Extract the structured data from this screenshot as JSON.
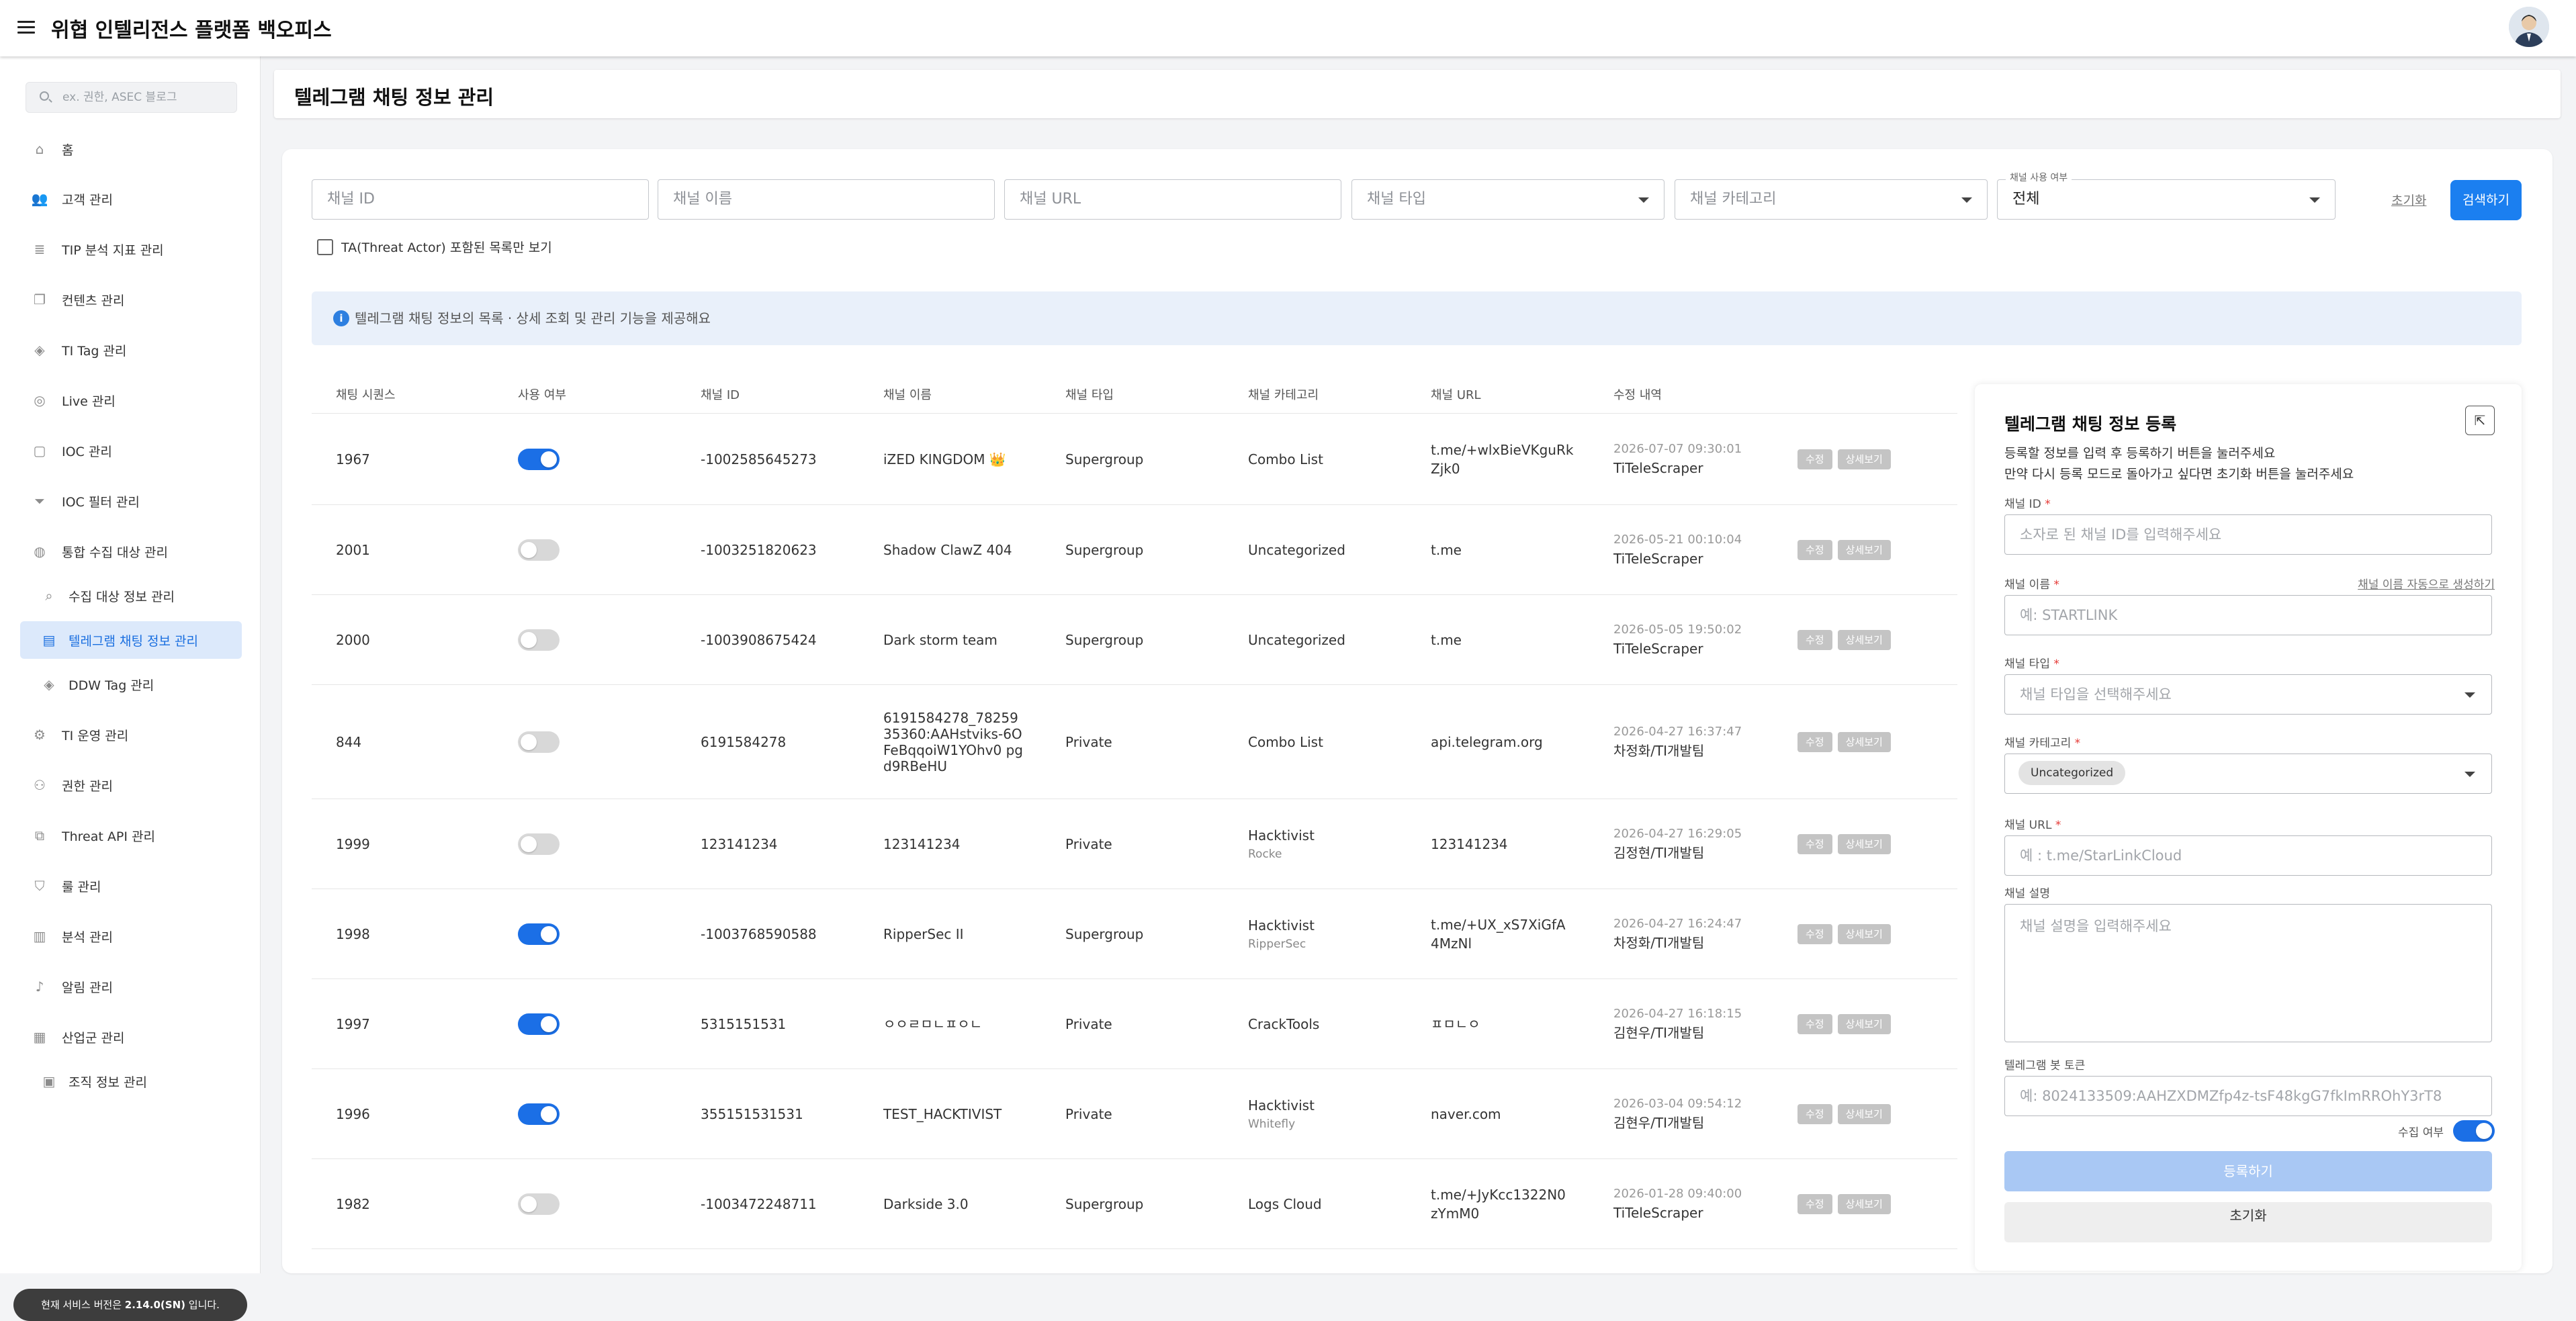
{
  "app": {
    "title": "위협 인텔리전스 플랫폼 백오피스"
  },
  "sidebar": {
    "search_placeholder": "ex. 권한, ASEC 블로그",
    "items": [
      {
        "label": "홈",
        "icon": "home-icon"
      },
      {
        "label": "고객 관리",
        "icon": "users-icon"
      },
      {
        "label": "TIP 분석 지표 관리",
        "icon": "database-icon"
      },
      {
        "label": "컨텐츠 관리",
        "icon": "copy-icon"
      },
      {
        "label": "TI Tag 관리",
        "icon": "tag-icon"
      },
      {
        "label": "Live 관리",
        "icon": "broadcast-icon"
      },
      {
        "label": "IOC 관리",
        "icon": "file-icon"
      },
      {
        "label": "IOC 필터 관리",
        "icon": "filter-icon"
      },
      {
        "label": "통합 수집 대상 관리",
        "icon": "globe-icon"
      },
      {
        "label": "수집 대상 정보 관리",
        "icon": "search-doc-icon"
      },
      {
        "label": "텔레그램 채팅 정보 관리",
        "icon": "chat-icon"
      },
      {
        "label": "DDW Tag 관리",
        "icon": "tag-icon"
      },
      {
        "label": "TI 운영 관리",
        "icon": "user-gear-icon"
      },
      {
        "label": "권한 관리",
        "icon": "group-icon"
      },
      {
        "label": "Threat API 관리",
        "icon": "api-icon"
      },
      {
        "label": "룰 관리",
        "icon": "shield-icon"
      },
      {
        "label": "분석 관리",
        "icon": "report-icon"
      },
      {
        "label": "알림 관리",
        "icon": "bell-icon"
      },
      {
        "label": "산업군 관리",
        "icon": "bar-chart-icon"
      },
      {
        "label": "조직 정보 관리",
        "icon": "org-icon"
      }
    ],
    "version_prefix": "현재 서비스 버전은 ",
    "version": "2.14.0(SN)",
    "version_suffix": " 입니다."
  },
  "page": {
    "title": "텔레그램 채팅 정보 관리"
  },
  "filters": {
    "channel_id": "채널 ID",
    "channel_name": "채널 이름",
    "channel_url": "채널 URL",
    "channel_type": "채널 타입",
    "channel_category": "채널 카테고리",
    "use_label": "채널 사용 여부",
    "use_value": "전체",
    "reset": "초기화",
    "search": "검색하기",
    "ta_only": "TA(Threat Actor) 포함된 목록만 보기"
  },
  "info": {
    "text": "텔레그램 채팅 정보의 목록 · 상세 조회 및 관리 기능을 제공해요"
  },
  "table": {
    "headers": [
      "채팅 시퀀스",
      "사용 여부",
      "채널 ID",
      "채널 이름",
      "채널 타입",
      "채널 카테고리",
      "채널 URL",
      "수정 내역"
    ],
    "edit_label": "수정",
    "detail_label": "상세보기",
    "rows": [
      {
        "seq": "1967",
        "enabled": true,
        "channel_id": "-1002585645273",
        "name": "iZED KINGDOM 👑",
        "type": "Supergroup",
        "category": "Combo List",
        "category_sub": "",
        "url": "t.me/+wlxBieVKguRk Zjk0",
        "mod_time": "2026-07-07 09:30:01",
        "mod_by": "TiTeleScraper"
      },
      {
        "seq": "2001",
        "enabled": false,
        "channel_id": "-1003251820623",
        "name": "Shadow ClawZ 404",
        "type": "Supergroup",
        "category": "Uncategorized",
        "category_sub": "",
        "url": "t.me",
        "mod_time": "2026-05-21 00:10:04",
        "mod_by": "TiTeleScraper"
      },
      {
        "seq": "2000",
        "enabled": false,
        "channel_id": "-1003908675424",
        "name": "Dark storm team",
        "type": "Supergroup",
        "category": "Uncategorized",
        "category_sub": "",
        "url": "t.me",
        "mod_time": "2026-05-05 19:50:02",
        "mod_by": "TiTeleScraper"
      },
      {
        "seq": "844",
        "enabled": false,
        "channel_id": "6191584278",
        "name": "6191584278_78259 35360:AAHstviks-6OFeBqqoiW1YOhv0 pgd9RBeHU",
        "type": "Private",
        "category": "Combo List",
        "category_sub": "",
        "url": "api.telegram.org",
        "mod_time": "2026-04-27 16:37:47",
        "mod_by": "차정화/TI개발팀"
      },
      {
        "seq": "1999",
        "enabled": false,
        "channel_id": "123141234",
        "name": "123141234",
        "type": "Private",
        "category": "Hacktivist",
        "category_sub": "Rocke",
        "url": "123141234",
        "mod_time": "2026-04-27 16:29:05",
        "mod_by": "김정현/TI개발팀"
      },
      {
        "seq": "1998",
        "enabled": true,
        "channel_id": "-1003768590588",
        "name": "RipperSec II",
        "type": "Supergroup",
        "category": "Hacktivist",
        "category_sub": "RipperSec",
        "url": "t.me/+UX_xS7XiGfA 4MzNl",
        "mod_time": "2026-04-27 16:24:47",
        "mod_by": "차정화/TI개발팀"
      },
      {
        "seq": "1997",
        "enabled": true,
        "channel_id": "5315151531",
        "name": "ㅇㅇㄹㅁㄴㅍㅇㄴ",
        "type": "Private",
        "category": "CrackTools",
        "category_sub": "",
        "url": "ㅍㅁㄴㅇ",
        "mod_time": "2026-04-27 16:18:15",
        "mod_by": "김현우/TI개발팀"
      },
      {
        "seq": "1996",
        "enabled": true,
        "channel_id": "355151531531",
        "name": "TEST_HACKTIVIST",
        "type": "Private",
        "category": "Hacktivist",
        "category_sub": "Whitefly",
        "url": "naver.com",
        "mod_time": "2026-03-04 09:54:12",
        "mod_by": "김현우/TI개발팀"
      },
      {
        "seq": "1982",
        "enabled": false,
        "channel_id": "-1003472248711",
        "name": "Darkside 3.0",
        "type": "Supergroup",
        "category": "Logs Cloud",
        "category_sub": "",
        "url": "t.me/+JyKcc1322N0 zYmM0",
        "mod_time": "2026-01-28 09:40:00",
        "mod_by": "TiTeleScraper"
      }
    ]
  },
  "register": {
    "title": "텔레그램 채팅 정보 등록",
    "desc1": "등록할 정보를 입력 후 등록하기 버튼을 눌러주세요",
    "desc2": "만약 다시 등록 모드로 돌아가고 싶다면 초기화 버튼을 눌러주세요",
    "id_label": "채널 ID",
    "id_placeholder": "소자로 된 채널 ID를 입력해주세요",
    "name_label": "채널 이름",
    "auto_name": "채널 이름 자동으로 생성하기",
    "name_placeholder": "예: STARTLINK",
    "type_label": "채널 타입",
    "type_placeholder": "채널 타입을 선택해주세요",
    "category_label": "채널 카테고리",
    "category_value": "Uncategorized",
    "url_label": "채널 URL",
    "url_placeholder": "예 : t.me/StarLinkCloud",
    "desc_label": "채널 설명",
    "desc_placeholder": "채널 설명을 입력해주세요",
    "token_label": "텔레그램 봇 토큰",
    "token_placeholder": "예: 8024133509:AAHZXDMZfp4z-tsF48kgG7fkImRROhY3rT8",
    "collect_label": "수집 여부",
    "collect_on": true,
    "submit": "등록하기",
    "reset": "초기화"
  }
}
